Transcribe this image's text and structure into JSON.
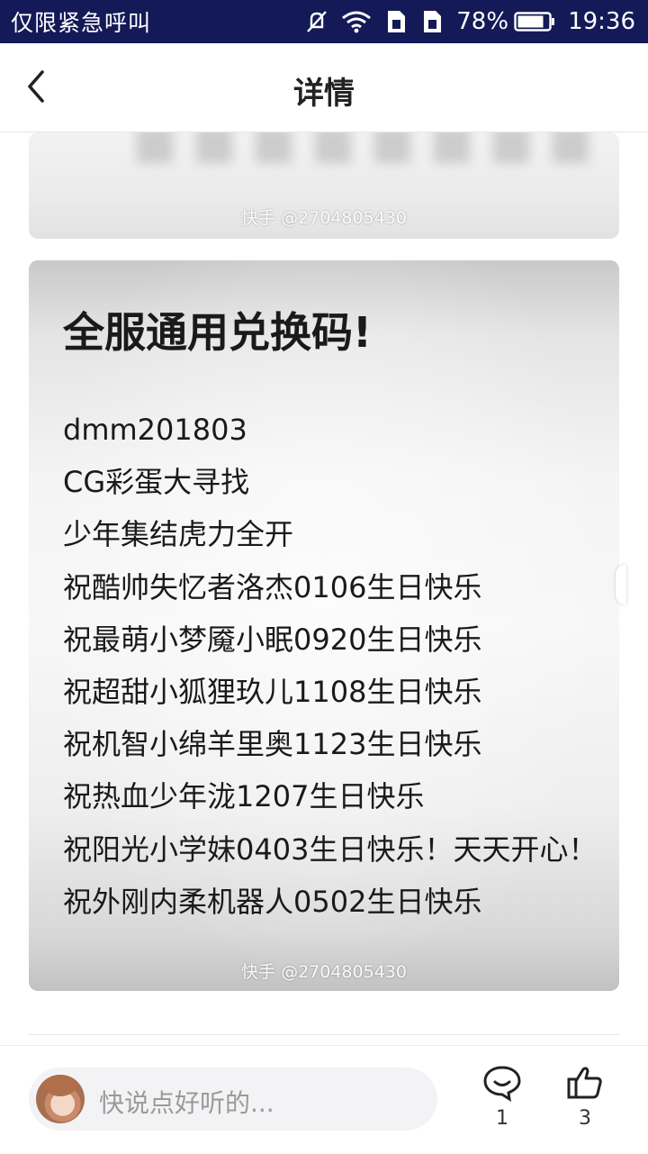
{
  "status_bar": {
    "carrier": "仅限紧急呼叫",
    "battery": "78%",
    "time": "19:36",
    "icons": [
      "mute-icon",
      "wifi-icon",
      "sim1-icon",
      "sim2-icon",
      "battery-icon"
    ]
  },
  "header": {
    "title": "详情",
    "back_icon": "chevron-left-icon"
  },
  "images": {
    "watermark": "快手 @2704805430",
    "main": {
      "title": "全服通用兑换码!",
      "codes": [
        "dmm201803",
        "CG彩蛋大寻找",
        "少年集结虎力全开",
        "祝酷帅失忆者洛杰0106生日快乐",
        "祝最萌小梦魇小眠0920生日快乐",
        "祝超甜小狐狸玖儿1108生日快乐",
        "祝机智小绵羊里奥1123生日快乐",
        "祝热血少年泷1207生日快乐",
        "祝阳光小学妹0403生日快乐！天天开心！",
        "祝外刚内柔机器人0502生日快乐"
      ]
    }
  },
  "bottom_bar": {
    "comment_placeholder": "快说点好听的...",
    "comment_count": "1",
    "like_count": "3",
    "comment_icon": "comment-bubble-icon",
    "like_icon": "thumbs-up-icon"
  }
}
